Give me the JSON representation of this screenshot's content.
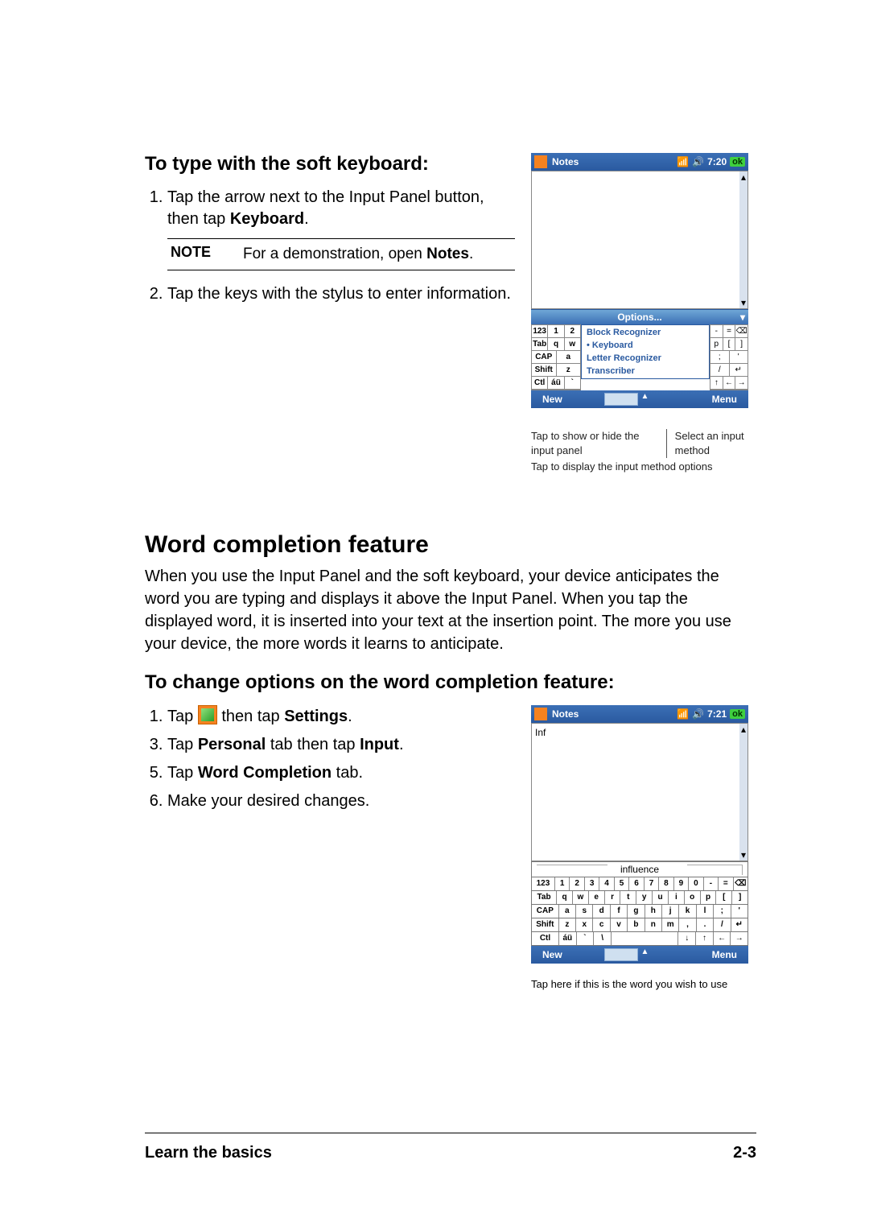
{
  "heading1": "To type with the soft keyboard:",
  "ol1": {
    "item1_pre": "Tap the arrow next to the Input Panel button, then tap ",
    "item1_bold": "Keyboard",
    "item1_post": ".",
    "item2": "Tap the keys with the stylus to enter information."
  },
  "note": {
    "label": "NOTE",
    "text_pre": "For a demonstration, open ",
    "text_bold": "Notes",
    "text_post": "."
  },
  "device1": {
    "title": "Notes",
    "time": "7:20",
    "ok": "ok",
    "options": "Options...",
    "menu_items": [
      "Block Recognizer",
      "Keyboard",
      "Letter Recognizer",
      "Transcriber"
    ],
    "kbd_left": [
      [
        "123",
        "1",
        "2"
      ],
      [
        "Tab",
        "q",
        "w"
      ],
      [
        "CAP",
        "a"
      ],
      [
        "Shift",
        "z"
      ],
      [
        "Ctl",
        "áü",
        "`"
      ]
    ],
    "kbd_right": [
      [
        "-",
        "=",
        "⌫"
      ],
      [
        "p",
        "[",
        "]"
      ],
      [
        ";",
        "'"
      ],
      [
        "/",
        "↵"
      ],
      [
        "↑",
        "←",
        "→"
      ]
    ],
    "new": "New",
    "menu_label": "Menu"
  },
  "captions1": {
    "a": "Tap to show or hide the input panel",
    "b": "Select an input method",
    "c": "Tap to display the input method options"
  },
  "section2": "Word completion feature",
  "para2": "When you use the Input Panel and the soft keyboard, your device anticipates the word you are typing and displays it above the Input Panel. When you tap the displayed word, it is inserted into your text at the insertion point. The more you use your device, the more words it learns to anticipate.",
  "heading2": "To change options on the word completion feature:",
  "ol2": {
    "item1_pre": "Tap ",
    "item1_mid": " then tap ",
    "item1_bold": "Settings",
    "item1_post": ".",
    "item3_pre": "Tap ",
    "item3_b1": "Personal",
    "item3_mid": " tab then tap ",
    "item3_b2": "Input",
    "item3_post": ".",
    "item5_pre": "Tap ",
    "item5_bold": "Word Completion",
    "item5_post": " tab.",
    "item6": "Make your desired changes."
  },
  "device2": {
    "title": "Notes",
    "time": "7:21",
    "ok": "ok",
    "typed": "Inf",
    "suggestion": "influence",
    "rows": [
      [
        "123",
        "1",
        "2",
        "3",
        "4",
        "5",
        "6",
        "7",
        "8",
        "9",
        "0",
        "-",
        "=",
        "⌫"
      ],
      [
        "Tab",
        "q",
        "w",
        "e",
        "r",
        "t",
        "y",
        "u",
        "i",
        "o",
        "p",
        "[",
        "]"
      ],
      [
        "CAP",
        "a",
        "s",
        "d",
        "f",
        "g",
        "h",
        "j",
        "k",
        "l",
        ";",
        "'"
      ],
      [
        "Shift",
        "z",
        "x",
        "c",
        "v",
        "b",
        "n",
        "m",
        ",",
        ".",
        "/",
        "↵"
      ],
      [
        "Ctl",
        "áü",
        "`",
        "\\",
        " ",
        " ",
        " ",
        "↓",
        "↑",
        "←",
        "→"
      ]
    ],
    "new": "New",
    "menu_label": "Menu"
  },
  "caption2": "Tap here if this is the word you wish to use",
  "footer": {
    "left": "Learn the basics",
    "right": "2-3"
  }
}
